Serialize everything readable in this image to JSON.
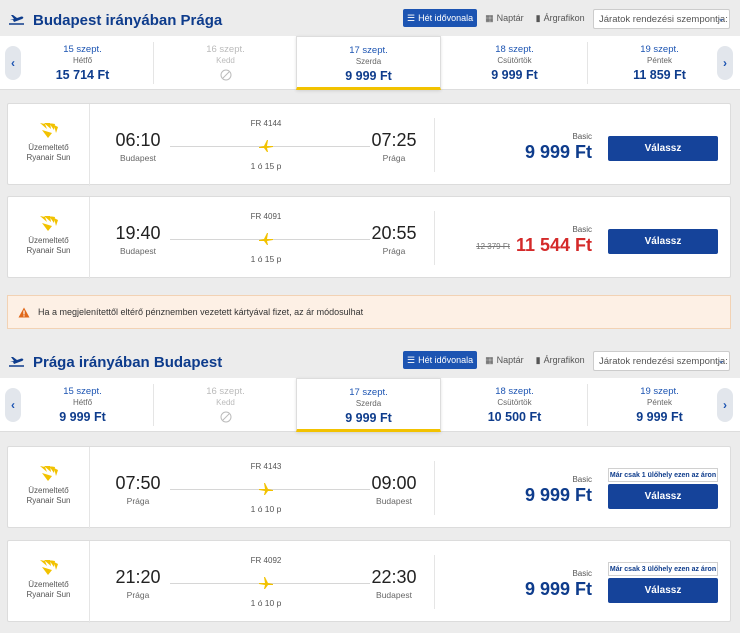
{
  "outbound": {
    "title": "Budapest irányában Prága",
    "view_toggle": {
      "week": "Hét idővonala",
      "calendar": "Naptár",
      "chart": "Árgrafikon"
    },
    "sort_label": "Járatok rendezési szempontja:",
    "dates": [
      {
        "date": "15 szept.",
        "weekday": "Hétfő",
        "price": "15 714 Ft"
      },
      {
        "date": "16 szept.",
        "weekday": "Kedd",
        "price": ""
      },
      {
        "date": "17 szept.",
        "weekday": "Szerda",
        "price": "9 999 Ft"
      },
      {
        "date": "18 szept.",
        "weekday": "Csütörtök",
        "price": "9 999 Ft"
      },
      {
        "date": "19 szept.",
        "weekday": "Péntek",
        "price": "11 859 Ft"
      }
    ],
    "flights": [
      {
        "operator_label": "Üzemeltető",
        "operator": "Ryanair Sun",
        "flight_no": "FR 4144",
        "dep_time": "06:10",
        "dep_city": "Budapest",
        "arr_time": "07:25",
        "arr_city": "Prága",
        "duration": "1 ó 15 p",
        "fare": "Basic",
        "old_price": "",
        "price": "9 999 Ft",
        "seats_note": "",
        "select_label": "Válassz"
      },
      {
        "operator_label": "Üzemeltető",
        "operator": "Ryanair Sun",
        "flight_no": "FR 4091",
        "dep_time": "19:40",
        "dep_city": "Budapest",
        "arr_time": "20:55",
        "arr_city": "Prága",
        "duration": "1 ó 15 p",
        "fare": "Basic",
        "old_price": "12 379 Ft",
        "price": "11 544 Ft",
        "seats_note": "",
        "select_label": "Válassz"
      }
    ]
  },
  "notice": {
    "text": "Ha a megjelenítettől eltérő pénznemben vezetett kártyával fizet, az ár módosulhat"
  },
  "inbound": {
    "title": "Prága irányában Budapest",
    "view_toggle": {
      "week": "Hét idővonala",
      "calendar": "Naptár",
      "chart": "Árgrafikon"
    },
    "sort_label": "Járatok rendezési szempontja:",
    "dates": [
      {
        "date": "15 szept.",
        "weekday": "Hétfő",
        "price": "9 999 Ft"
      },
      {
        "date": "16 szept.",
        "weekday": "Kedd",
        "price": ""
      },
      {
        "date": "17 szept.",
        "weekday": "Szerda",
        "price": "9 999 Ft"
      },
      {
        "date": "18 szept.",
        "weekday": "Csütörtök",
        "price": "10 500 Ft"
      },
      {
        "date": "19 szept.",
        "weekday": "Péntek",
        "price": "9 999 Ft"
      }
    ],
    "flights": [
      {
        "operator_label": "Üzemeltető",
        "operator": "Ryanair Sun",
        "flight_no": "FR 4143",
        "dep_time": "07:50",
        "dep_city": "Prága",
        "arr_time": "09:00",
        "arr_city": "Budapest",
        "duration": "1 ó 10 p",
        "fare": "Basic",
        "old_price": "",
        "price": "9 999 Ft",
        "seats_note": "Már csak 1 ülőhely ezen az áron",
        "select_label": "Válassz"
      },
      {
        "operator_label": "Üzemeltető",
        "operator": "Ryanair Sun",
        "flight_no": "FR 4092",
        "dep_time": "21:20",
        "dep_city": "Prága",
        "arr_time": "22:30",
        "arr_city": "Budapest",
        "duration": "1 ó 10 p",
        "fare": "Basic",
        "old_price": "",
        "price": "9 999 Ft",
        "seats_note": "Már csak 3 ülőhely ezen az áron",
        "select_label": "Válassz"
      }
    ]
  },
  "colors": {
    "brand_blue": "#0e3c8c",
    "button_blue": "#15439a",
    "highlight_yellow": "#f2c200",
    "sale_red": "#d42a2a",
    "notice_bg": "#fdf0e5"
  }
}
